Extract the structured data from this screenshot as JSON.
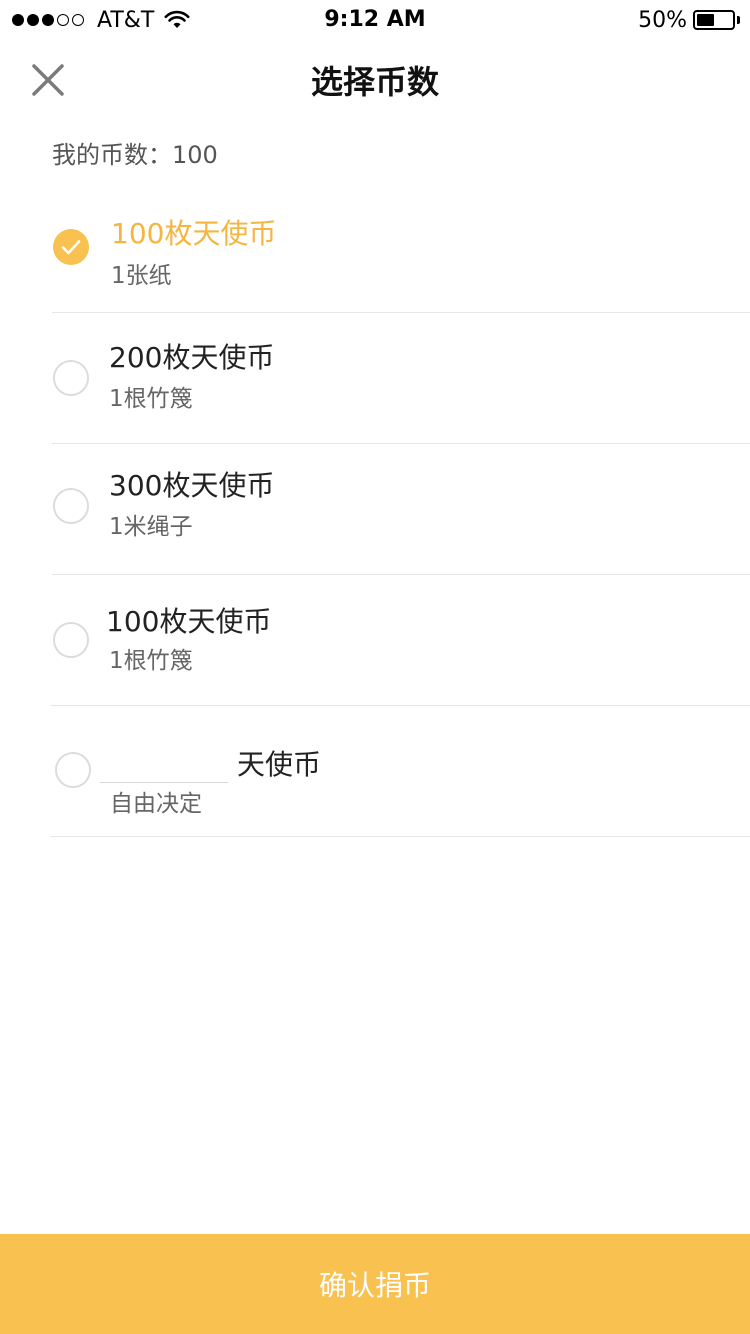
{
  "status_bar": {
    "carrier": "AT&T",
    "time": "9:12 AM",
    "battery": "50%",
    "battery_level": 0.5
  },
  "header": {
    "title": "选择币数"
  },
  "balance": {
    "text": "我的币数：100"
  },
  "options": [
    {
      "title": "100枚天使币",
      "subtitle": "1张纸",
      "selected": true
    },
    {
      "title": "200枚天使币",
      "subtitle": "1根竹篾",
      "selected": false
    },
    {
      "title": "300枚天使币",
      "subtitle": "1米绳子",
      "selected": false
    },
    {
      "title": "100枚天使币",
      "subtitle": "1根竹篾",
      "selected": false
    }
  ],
  "custom_option": {
    "input_value": "",
    "unit_label": "天使币",
    "subtitle": "自由决定",
    "selected": false
  },
  "confirm": {
    "label": "确认捐币"
  },
  "colors": {
    "accent": "#f9c150",
    "selected_text": "#f5b53f"
  },
  "icons": {
    "close": "close-icon",
    "check": "check-icon",
    "wifi": "wifi-icon",
    "battery": "battery-icon"
  }
}
